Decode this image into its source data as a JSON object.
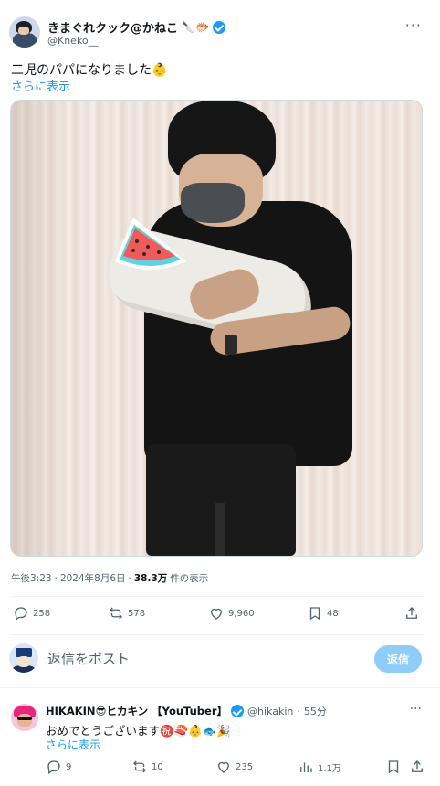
{
  "post": {
    "display_name": "きまぐれクック@かねこ",
    "name_emojis": "🔪🐡",
    "handle": "@Kneko__",
    "text": "二児のパパになりました👶",
    "show_more": "さらに表示",
    "meta": {
      "time": "午後3:23",
      "sep": "·",
      "date": "2024年8月6日",
      "views": "38.3万",
      "views_label": "件の表示"
    },
    "actions": {
      "replies": "258",
      "reposts": "578",
      "likes": "9,960",
      "bookmarks": "48"
    }
  },
  "reply_box": {
    "placeholder": "返信をポスト",
    "button": "返信"
  },
  "reply": {
    "display_name": "HIKAKIN😎ヒカキン 【YouTuber】",
    "handle": "@hikakin",
    "sep": "·",
    "time": "55分",
    "text": "おめでとうございます㊗️🍣👶🐟🎉",
    "show_more": "さらに表示",
    "actions": {
      "replies": "9",
      "reposts": "10",
      "likes": "235",
      "views": "1.1万"
    }
  },
  "colors": {
    "accent": "#1d9bf0",
    "muted": "#536471",
    "reply_button_disabled": "#8ecdf8"
  },
  "icons": [
    "more-icon",
    "verified-icon",
    "reply-icon",
    "repost-icon",
    "like-icon",
    "bookmark-icon",
    "share-icon",
    "views-icon",
    "watermelon-sticker-icon"
  ]
}
